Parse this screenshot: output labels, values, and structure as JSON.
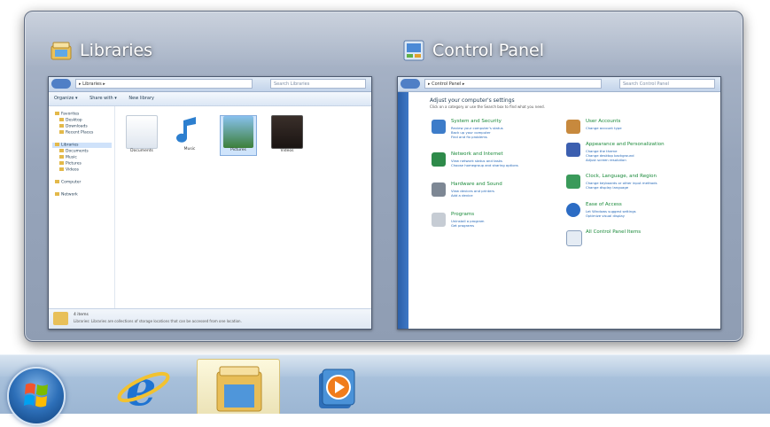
{
  "peek": {
    "libraries": {
      "title": "Libraries",
      "address": "▸ Libraries ▸",
      "search_placeholder": "Search Libraries",
      "toolbar": [
        "Organize ▾",
        "Share with ▾",
        "New library"
      ],
      "nav_items": [
        "Favorites",
        "Desktop",
        "Downloads",
        "Recent Places",
        "Libraries",
        "Documents",
        "Music",
        "Pictures",
        "Videos",
        "Computer",
        "Network"
      ],
      "libs": [
        "Documents",
        "Music",
        "Pictures",
        "Videos"
      ],
      "details_title": "4 items",
      "details_text": "Libraries: Libraries are collections of storage locations that can be accessed from one location."
    },
    "control_panel": {
      "title": "Control Panel",
      "address": "▸ Control Panel ▸",
      "search_placeholder": "Search Control Panel",
      "heading": "Adjust your computer's settings",
      "subheading": "Click on a category or use the Search box to find what you need.",
      "categories_left": [
        {
          "title": "System and Security",
          "links": [
            "Review your computer's status",
            "Back up your computer",
            "Find and fix problems"
          ]
        },
        {
          "title": "Network and Internet",
          "links": [
            "View network status and tasks",
            "Choose homegroup and sharing options"
          ]
        },
        {
          "title": "Hardware and Sound",
          "links": [
            "View devices and printers",
            "Add a device"
          ]
        },
        {
          "title": "Programs",
          "links": [
            "Uninstall a program",
            "Get programs"
          ]
        }
      ],
      "categories_right": [
        {
          "title": "User Accounts",
          "links": [
            "Change account type"
          ]
        },
        {
          "title": "Appearance and Personalization",
          "links": [
            "Change the theme",
            "Change desktop background",
            "Adjust screen resolution"
          ]
        },
        {
          "title": "Clock, Language, and Region",
          "links": [
            "Change keyboards or other input methods",
            "Change display language"
          ]
        },
        {
          "title": "Ease of Access",
          "links": [
            "Let Windows suggest settings",
            "Optimize visual display"
          ]
        },
        {
          "title": "All Control Panel Items",
          "links": []
        }
      ]
    }
  },
  "taskbar": {
    "items": [
      "start-button",
      "internet-explorer",
      "windows-explorer",
      "windows-media-player"
    ],
    "active": "windows-explorer"
  }
}
